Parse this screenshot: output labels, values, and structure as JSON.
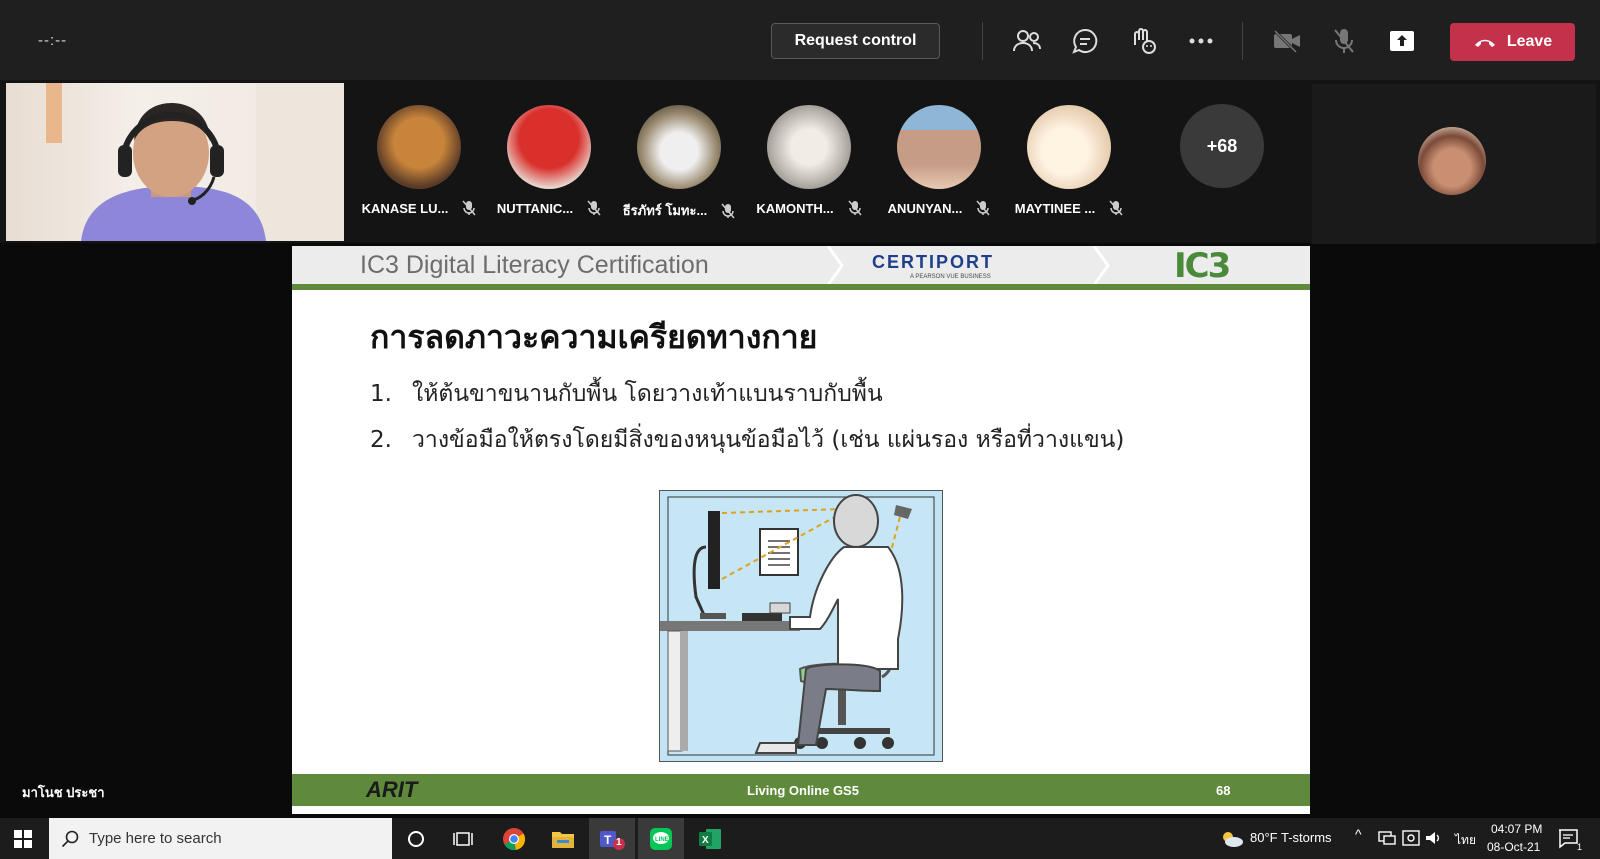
{
  "topbar": {
    "timer": "--:--",
    "request_control_label": "Request control",
    "leave_label": "Leave",
    "icons": [
      "people-icon",
      "chat-icon",
      "raise-hand-icon",
      "more-options-icon",
      "camera-off-icon",
      "mic-off-icon",
      "share-tray-icon",
      "phone-hangup-icon"
    ]
  },
  "participants": [
    {
      "name": "KANASE LU...",
      "avatar_color": "#c8843a"
    },
    {
      "name": "NUTTANIC...",
      "avatar_color": "#d9302c"
    },
    {
      "name": "ธีรภัทร์ โมทะ...",
      "avatar_color": "#9a8a70"
    },
    {
      "name": "KAMONTH...",
      "avatar_color": "#b9b4ac"
    },
    {
      "name": "ANUNYAN...",
      "avatar_color": "#c59c86"
    },
    {
      "name": "MAYTINEE ...",
      "avatar_color": "#f0dcc4"
    }
  ],
  "overflow_count": "+68",
  "presenter_name": "มาโนช ประชา",
  "slide": {
    "header_title": "IC3 Digital Literacy Certification",
    "certiport": "CERTIPORT",
    "certiport_sub": "A PEARSON VUE BUSINESS",
    "ic3_logo": "IC3",
    "title": "การลดภาวะความเครียดทางกาย",
    "bullets": [
      {
        "num": "1.",
        "text": "ให้ต้นขาขนานกับพื้น โดยวางเท้าแบนราบกับพื้น"
      },
      {
        "num": "2.",
        "text": "วางข้อมือให้ตรงโดยมีสิ่งของหนุนข้อมือไว้ (เช่น แผ่นรอง หรือที่วางแขน)"
      }
    ],
    "footer_logo": "ARIT",
    "footer_text": "Living Online GS5",
    "page_number": "68"
  },
  "taskbar": {
    "search_placeholder": "Type here to search",
    "weather": "80°F  T-storms",
    "language": "ไทย",
    "time": "04:07 PM",
    "date": "08-Oct-21",
    "teams_badge": "1",
    "notification_count": "1"
  },
  "colors": {
    "leave": "#c4314b",
    "slide_green": "#5f8a3b",
    "topbar": "#1f1f1f"
  }
}
